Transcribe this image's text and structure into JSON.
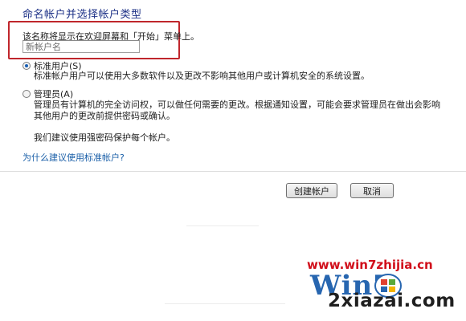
{
  "page": {
    "heading": "命名帐户并选择帐户类型",
    "hint": "该名称将显示在欢迎屏幕和「开始」菜单上。",
    "name_input": {
      "value": "",
      "placeholder": "新帐户名"
    }
  },
  "account_types": [
    {
      "label": "标准用户(S)",
      "checked": true,
      "description": [
        "标准帐户用户可以使用大多数软件以及更改不影响其他用户或计算机安全的系统设置。"
      ]
    },
    {
      "label": "管理员(A)",
      "checked": false,
      "description": [
        "管理员有计算机的完全访问权，可以做任何需要的更改。根据通知设置，可能会要求管理员在做出会影响",
        "其他用户的更改前提供密码或确认。"
      ]
    }
  ],
  "recommendation": "我们建议使用强密码保护每个帐户。",
  "help_link": "为什么建议使用标准帐户?",
  "buttons": {
    "create": "创建帐户",
    "cancel": "取消"
  },
  "watermark": {
    "url": "www.win7zhijia.cn",
    "logo": "Win7",
    "site": "2xiazai.com"
  },
  "colors": {
    "heading": "#1e3287",
    "link": "#1a5fa8",
    "highlight_box": "#c0262c",
    "watermark_red": "#d10f1b",
    "watermark_blue": "#2766b0"
  }
}
